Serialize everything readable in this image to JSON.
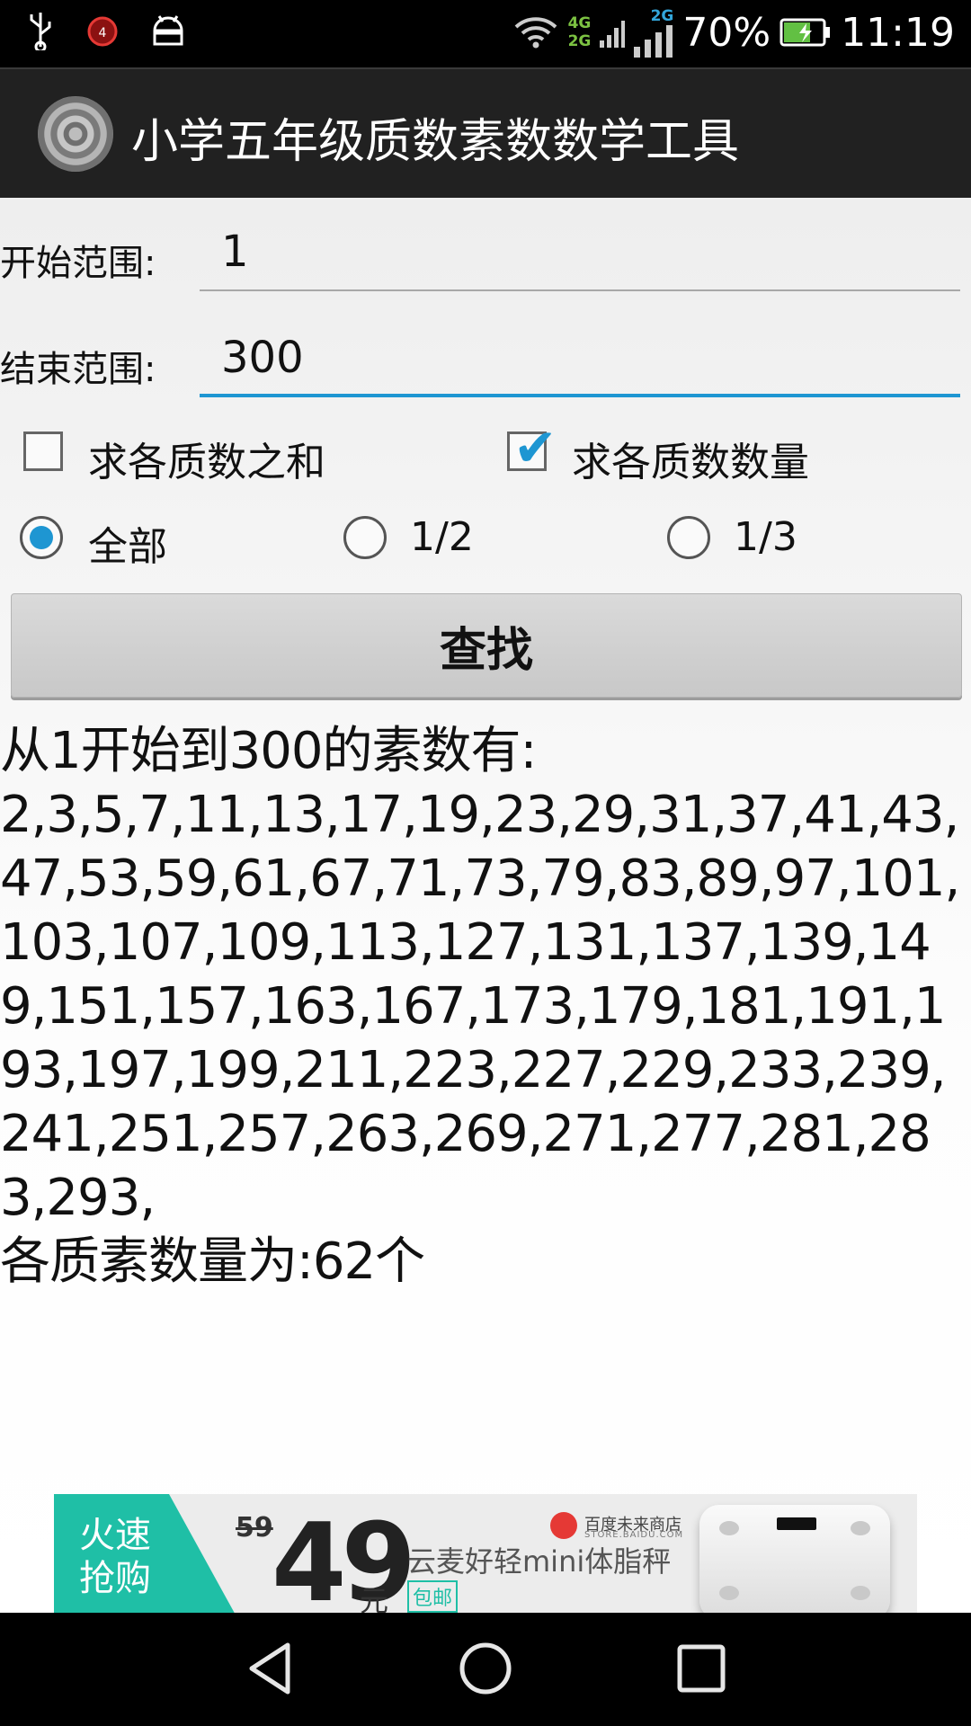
{
  "status_bar": {
    "icons_left": [
      "usb-icon",
      "alarm-badge-icon",
      "android-debug-icon"
    ],
    "network_4g": "4G",
    "network_2g": "2G",
    "network_2g_b": "2G",
    "battery_percent": "70%",
    "time": "11:19",
    "battery_level": 0.7
  },
  "app": {
    "title": "小学五年级质数素数数学工具"
  },
  "form": {
    "start_label": "开始范围:",
    "start_value": "1",
    "end_label": "结束范围:",
    "end_value": "300",
    "sum_label": "求各质数之和",
    "sum_checked": false,
    "count_label": "求各质数数量",
    "count_checked": true,
    "radio_all": "全部",
    "radio_half": "1/2",
    "radio_third": "1/3",
    "selected_radio": "全部",
    "find_button": "查找"
  },
  "result": {
    "heading": "从1开始到300的素数有:",
    "primes": "2,3,5,7,11,13,17,19,23,29,31,37,41,43,47,53,59,61,67,71,73,79,83,89,97,101,103,107,109,113,127,131,137,139,149,151,157,163,167,173,179,181,191,193,197,199,211,223,227,229,233,239,241,251,257,263,269,271,277,281,283,293,",
    "count_text": "各质素数量为:62个"
  },
  "ad": {
    "flash_sale": "火速抢购",
    "old_price": "59",
    "price": "49",
    "unit": "元",
    "store": "百度未来商店",
    "store_sub": "STORE.BAIDU.COM",
    "product": "云麦好轻mini体脂秤",
    "free_shipping": "包邮",
    "accent_color": "#1fbfa6"
  },
  "nav_bar": {
    "buttons": [
      "back-icon",
      "home-icon",
      "recents-icon"
    ]
  },
  "colors": {
    "accent": "#1e96d2",
    "action_bar": "#212121"
  }
}
